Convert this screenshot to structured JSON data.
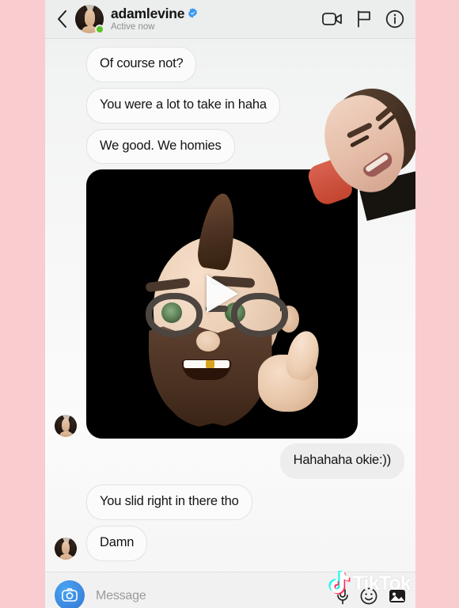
{
  "app": {
    "platform": "instagram-direct-message",
    "frame_color": "#f9ccd0",
    "accent_blue": "#3897f0",
    "online_green": "#57c522"
  },
  "header": {
    "back_icon": "chevron-left-icon",
    "username": "adamlevine",
    "verified": true,
    "status": "Active now",
    "avatar_alt": "profile-photo",
    "actions": [
      {
        "name": "video-call-icon",
        "label": "Video call"
      },
      {
        "name": "flag-icon",
        "label": "Flag"
      },
      {
        "name": "info-icon",
        "label": "Info"
      }
    ]
  },
  "thread": {
    "messages": [
      {
        "id": "m1",
        "direction": "in",
        "text": "Of course not?",
        "avatar": false
      },
      {
        "id": "m2",
        "direction": "in",
        "text": "You were a lot to take in haha",
        "avatar": false
      },
      {
        "id": "m3",
        "direction": "in",
        "text": "We good. We homies",
        "avatar": false
      },
      {
        "id": "m4",
        "direction": "in",
        "type": "video",
        "avatar": true,
        "play_label": "play-button"
      },
      {
        "id": "m5",
        "direction": "out",
        "text": "Hahahaha okie:))",
        "avatar": false
      },
      {
        "id": "m6",
        "direction": "in",
        "text": "You slid right in there tho",
        "avatar": false
      },
      {
        "id": "m7",
        "direction": "in",
        "text": "Damn",
        "avatar": true
      }
    ]
  },
  "composer": {
    "camera_icon": "camera-icon",
    "placeholder": "Message",
    "icons": [
      {
        "name": "microphone-icon"
      },
      {
        "name": "sticker-icon"
      },
      {
        "name": "gallery-icon"
      }
    ]
  },
  "watermark": {
    "text": "TikTok",
    "note_icon": "tiktok-note-icon",
    "cyan": "#25f4ee",
    "pink": "#fe2c55"
  }
}
